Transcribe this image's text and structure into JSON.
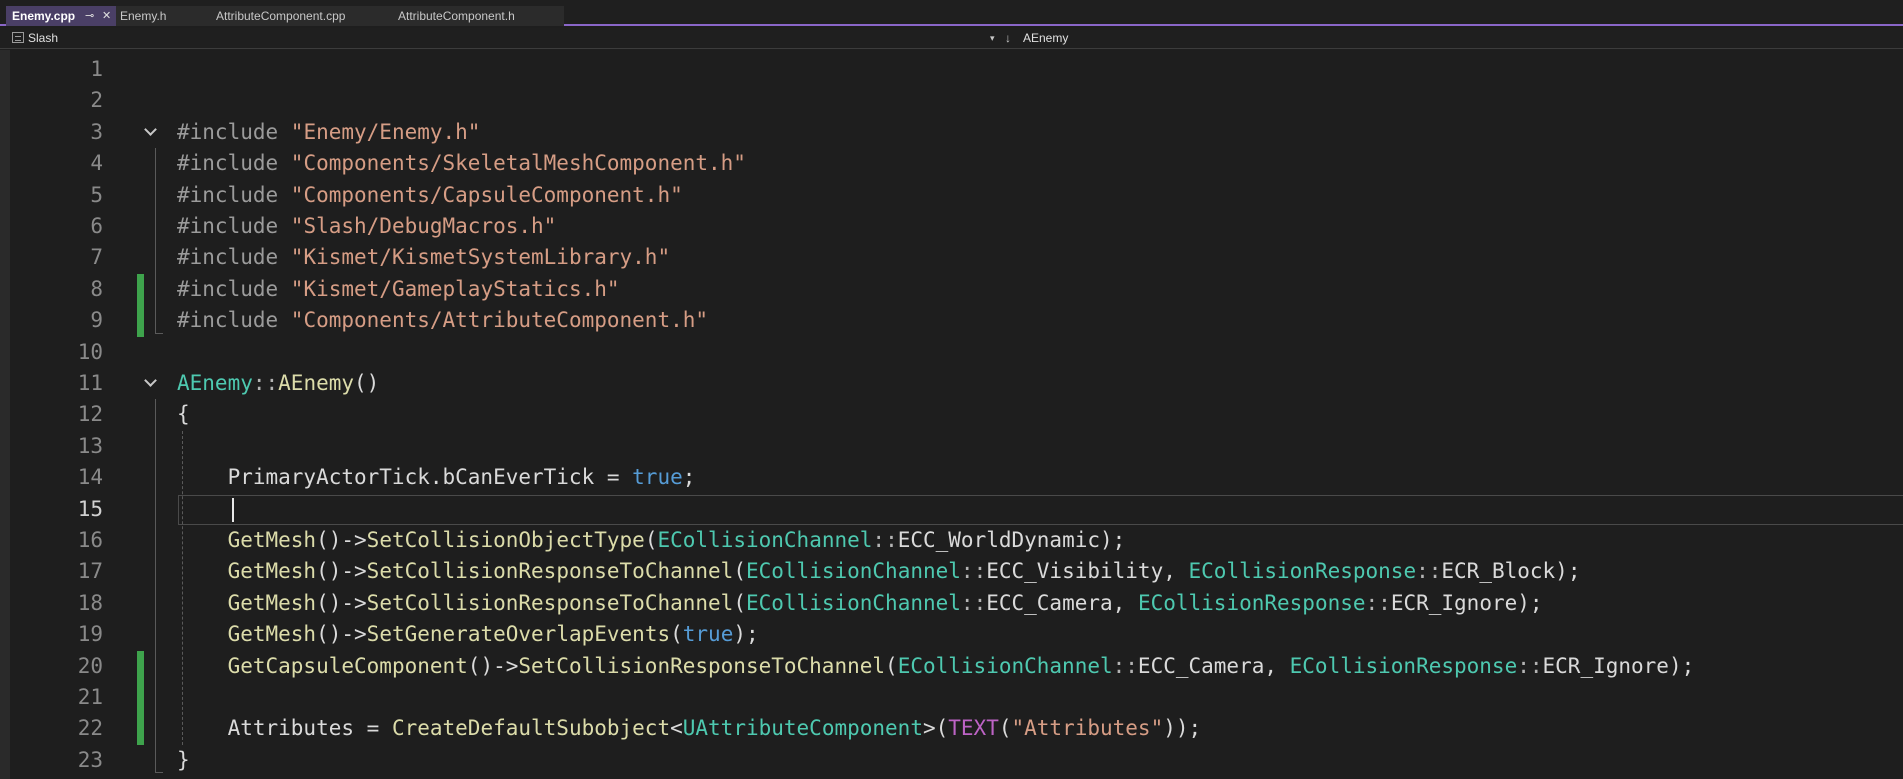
{
  "tabs": [
    {
      "label": "Enemy.cpp",
      "active": true,
      "pin": "⊸",
      "close": "✕"
    },
    {
      "label": "Enemy.h",
      "active": false
    },
    {
      "label": "AttributeComponent.cpp",
      "active": false
    },
    {
      "label": "AttributeComponent.h",
      "active": false
    }
  ],
  "navbar": {
    "scope": "Slash",
    "scope_icon": "project-scope-icon",
    "scope_chevron": "▾",
    "member_icon": "↓",
    "member": "AEnemy"
  },
  "editor": {
    "current_line": 15,
    "lines": [
      {
        "n": "1",
        "tokens": []
      },
      {
        "n": "2",
        "tokens": []
      },
      {
        "n": "3",
        "fold": true,
        "tokens": [
          [
            "pp",
            "#include "
          ],
          [
            "str",
            "\"Enemy/Enemy.h\""
          ]
        ]
      },
      {
        "n": "4",
        "tokens": [
          [
            "pp",
            "#include "
          ],
          [
            "str",
            "\"Components/SkeletalMeshComponent.h\""
          ]
        ]
      },
      {
        "n": "5",
        "tokens": [
          [
            "pp",
            "#include "
          ],
          [
            "str",
            "\"Components/CapsuleComponent.h\""
          ]
        ]
      },
      {
        "n": "6",
        "tokens": [
          [
            "pp",
            "#include "
          ],
          [
            "str",
            "\"Slash/DebugMacros.h\""
          ]
        ]
      },
      {
        "n": "7",
        "tokens": [
          [
            "pp",
            "#include "
          ],
          [
            "str",
            "\"Kismet/KismetSystemLibrary.h\""
          ]
        ]
      },
      {
        "n": "8",
        "changed": true,
        "tokens": [
          [
            "pp",
            "#include "
          ],
          [
            "str",
            "\"Kismet/GameplayStatics.h\""
          ]
        ]
      },
      {
        "n": "9",
        "changed": true,
        "tokens": [
          [
            "pp",
            "#include "
          ],
          [
            "str",
            "\"Components/AttributeComponent.h\""
          ]
        ]
      },
      {
        "n": "10",
        "tokens": []
      },
      {
        "n": "11",
        "fold": true,
        "tokens": [
          [
            "type",
            "AEnemy"
          ],
          [
            "op",
            "::"
          ],
          [
            "fn",
            "AEnemy"
          ],
          [
            "plain",
            "()"
          ]
        ]
      },
      {
        "n": "12",
        "tokens": [
          [
            "plain",
            "{"
          ]
        ]
      },
      {
        "n": "13",
        "tokens": []
      },
      {
        "n": "14",
        "tokens": [
          [
            "plain",
            "    PrimaryActorTick.bCanEverTick = "
          ],
          [
            "kw",
            "true"
          ],
          [
            "plain",
            ";"
          ]
        ]
      },
      {
        "n": "15",
        "tokens": []
      },
      {
        "n": "16",
        "tokens": [
          [
            "plain",
            "    "
          ],
          [
            "fn",
            "GetMesh"
          ],
          [
            "plain",
            "()->"
          ],
          [
            "fn",
            "SetCollisionObjectType"
          ],
          [
            "plain",
            "("
          ],
          [
            "type",
            "ECollisionChannel"
          ],
          [
            "op",
            "::"
          ],
          [
            "plain",
            "ECC_WorldDynamic);"
          ]
        ]
      },
      {
        "n": "17",
        "tokens": [
          [
            "plain",
            "    "
          ],
          [
            "fn",
            "GetMesh"
          ],
          [
            "plain",
            "()->"
          ],
          [
            "fn",
            "SetCollisionResponseToChannel"
          ],
          [
            "plain",
            "("
          ],
          [
            "type",
            "ECollisionChannel"
          ],
          [
            "op",
            "::"
          ],
          [
            "plain",
            "ECC_Visibility, "
          ],
          [
            "type",
            "ECollisionResponse"
          ],
          [
            "op",
            "::"
          ],
          [
            "plain",
            "ECR_Block);"
          ]
        ]
      },
      {
        "n": "18",
        "tokens": [
          [
            "plain",
            "    "
          ],
          [
            "fn",
            "GetMesh"
          ],
          [
            "plain",
            "()->"
          ],
          [
            "fn",
            "SetCollisionResponseToChannel"
          ],
          [
            "plain",
            "("
          ],
          [
            "type",
            "ECollisionChannel"
          ],
          [
            "op",
            "::"
          ],
          [
            "plain",
            "ECC_Camera, "
          ],
          [
            "type",
            "ECollisionResponse"
          ],
          [
            "op",
            "::"
          ],
          [
            "plain",
            "ECR_Ignore);"
          ]
        ]
      },
      {
        "n": "19",
        "tokens": [
          [
            "plain",
            "    "
          ],
          [
            "fn",
            "GetMesh"
          ],
          [
            "plain",
            "()->"
          ],
          [
            "fn",
            "SetGenerateOverlapEvents"
          ],
          [
            "plain",
            "("
          ],
          [
            "kw",
            "true"
          ],
          [
            "plain",
            ");"
          ]
        ]
      },
      {
        "n": "20",
        "changed": true,
        "tokens": [
          [
            "plain",
            "    "
          ],
          [
            "fn",
            "GetCapsuleComponent"
          ],
          [
            "plain",
            "()->"
          ],
          [
            "fn",
            "SetCollisionResponseToChannel"
          ],
          [
            "plain",
            "("
          ],
          [
            "type",
            "ECollisionChannel"
          ],
          [
            "op",
            "::"
          ],
          [
            "plain",
            "ECC_Camera, "
          ],
          [
            "type",
            "ECollisionResponse"
          ],
          [
            "op",
            "::"
          ],
          [
            "plain",
            "ECR_Ignore);"
          ]
        ]
      },
      {
        "n": "21",
        "changed": true,
        "tokens": []
      },
      {
        "n": "22",
        "changed": true,
        "tokens": [
          [
            "plain",
            "    Attributes = "
          ],
          [
            "fn",
            "CreateDefaultSubobject"
          ],
          [
            "plain",
            "<"
          ],
          [
            "type",
            "UAttributeComponent"
          ],
          [
            "plain",
            ">("
          ],
          [
            "macro",
            "TEXT"
          ],
          [
            "plain",
            "("
          ],
          [
            "str",
            "\"Attributes\""
          ],
          [
            "plain",
            "));"
          ]
        ]
      },
      {
        "n": "23",
        "tokens": [
          [
            "plain",
            "}"
          ]
        ]
      }
    ]
  }
}
